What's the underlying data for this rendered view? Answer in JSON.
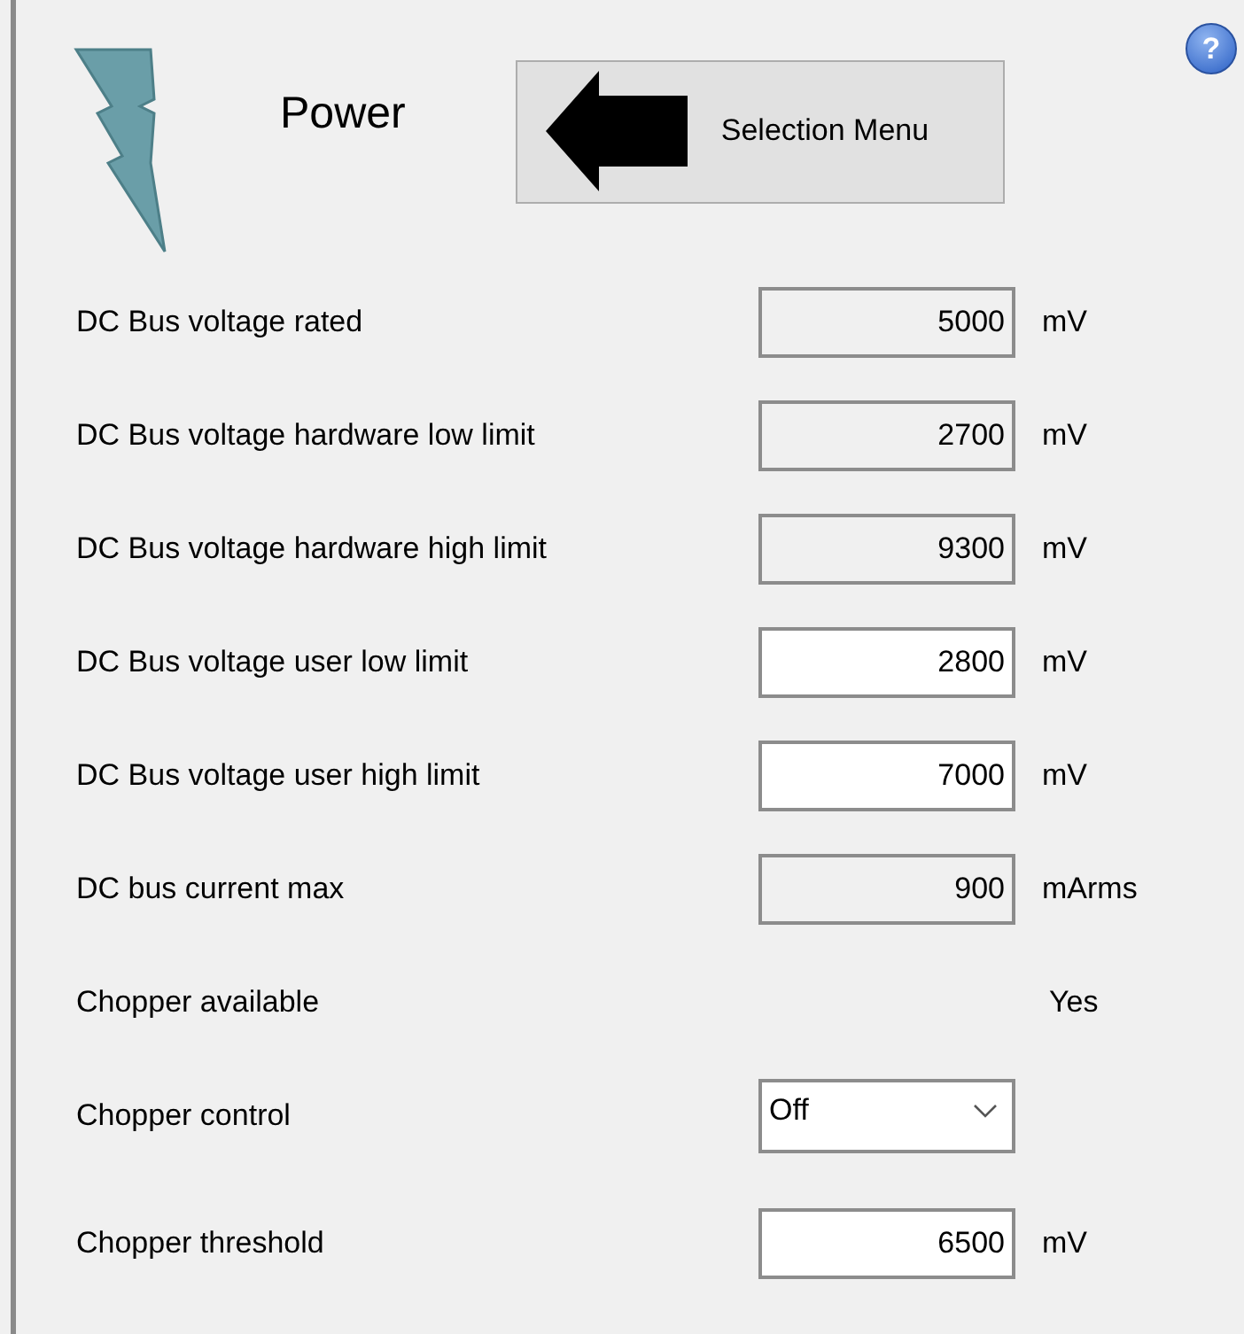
{
  "header": {
    "title": "Power",
    "back_button": "Selection Menu",
    "help_button": "?"
  },
  "rows": [
    {
      "kind": "field",
      "label": "DC Bus voltage rated",
      "value": "5000",
      "unit": "mV",
      "disabled": true
    },
    {
      "kind": "field",
      "label": "DC Bus voltage hardware low limit",
      "value": "2700",
      "unit": "mV",
      "disabled": true
    },
    {
      "kind": "field",
      "label": "DC Bus voltage hardware high limit",
      "value": "9300",
      "unit": "mV",
      "disabled": true
    },
    {
      "kind": "field",
      "label": "DC Bus voltage user low limit",
      "value": "2800",
      "unit": "mV",
      "disabled": false
    },
    {
      "kind": "field",
      "label": "DC Bus voltage user high limit",
      "value": "7000",
      "unit": "mV",
      "disabled": false
    },
    {
      "kind": "field",
      "label": "DC bus current max",
      "value": "900",
      "unit": "mArms",
      "disabled": true
    },
    {
      "kind": "text",
      "label": "Chopper available",
      "value": "Yes"
    },
    {
      "kind": "dropdown",
      "label": "Chopper control",
      "value": "Off"
    },
    {
      "kind": "field",
      "label": "Chopper threshold",
      "value": "6500",
      "unit": "mV",
      "disabled": false
    }
  ]
}
